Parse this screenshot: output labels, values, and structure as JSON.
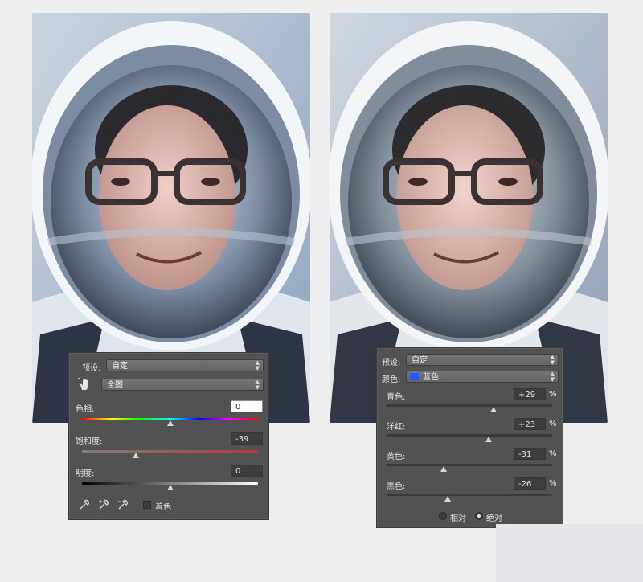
{
  "hue_saturation_panel": {
    "preset_label": "预设:",
    "preset_value": "自定",
    "channel_value": "全图",
    "hue_label": "色相:",
    "hue_value": "0",
    "hue_level": 0,
    "saturation_label": "饱和度:",
    "saturation_value": "-39",
    "saturation_level": -39,
    "lightness_label": "明度:",
    "lightness_value": "0",
    "lightness_level": 0,
    "colorize_label": "着色",
    "colorize_checked": false
  },
  "selective_color_panel": {
    "preset_label": "预设:",
    "preset_value": "自定",
    "colors_label": "颜色:",
    "colors_value": "蓝色",
    "colors_swatch": "#1a5cff",
    "sliders": [
      {
        "label": "青色:",
        "value": "+29",
        "level": 29,
        "unit": "%"
      },
      {
        "label": "洋红:",
        "value": "+23",
        "level": 23,
        "unit": "%"
      },
      {
        "label": "黄色:",
        "value": "-31",
        "level": -31,
        "unit": "%"
      },
      {
        "label": "黑色:",
        "value": "-26",
        "level": -26,
        "unit": "%"
      }
    ],
    "method_relative_label": "相对",
    "method_absolute_label": "绝对",
    "method_selected": "绝对"
  },
  "colors": {
    "panel_bg": "#525252",
    "saturation_track": "#b43a3a",
    "hue_gradient": [
      "#ff0000",
      "#ffff00",
      "#00ff00",
      "#00ffff",
      "#0000ff",
      "#ff00ff",
      "#ff0000"
    ]
  },
  "icons": [
    "hand-target-icon",
    "eyedropper-icon",
    "eyedropper-plus-icon",
    "eyedropper-minus-icon",
    "dropdown-arrow-icon"
  ]
}
